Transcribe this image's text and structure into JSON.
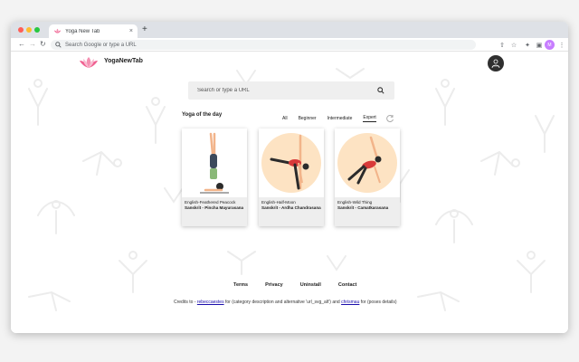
{
  "browser": {
    "tab_title": "Yoga New Tab",
    "tab_close": "×",
    "new_tab": "+",
    "omnibox_placeholder": "Search Google or type a URL",
    "profile_initial": "M"
  },
  "header": {
    "brand": "YogaNewTab"
  },
  "search": {
    "placeholder": "Search or type a URL"
  },
  "yoga": {
    "title": "Yoga of the day",
    "filters": [
      "All",
      "Beginner",
      "Intermediate",
      "Expert"
    ],
    "active_filter": "Expert",
    "cards": [
      {
        "english": "English-Feathered Peacock",
        "sanskrit": "Sanskrit - Pincha Mayurasana"
      },
      {
        "english": "English-Half-Moon",
        "sanskrit": "Sanskrit - Ardha Chandrasana"
      },
      {
        "english": "English-Wild Thing",
        "sanskrit": "Sanskrit - Camatkarasana"
      }
    ]
  },
  "footer": {
    "links": [
      "Terms",
      "Privacy",
      "Uninstall",
      "Contact"
    ],
    "credits_prefix": "Credits to - ",
    "credit_link_1": "rebeccaestes",
    "credits_middle": " for (category description and alternative 'url_svg_alt') and ",
    "credit_link_2": "chrismau",
    "credits_suffix": " for (poses details)"
  },
  "colors": {
    "pose_circle": "#fde3c3",
    "accent_lotus": "#f48fb1",
    "skin": "#f2b48a",
    "outfit_red": "#d83a3a",
    "outfit_dark": "#2b2b2b"
  }
}
